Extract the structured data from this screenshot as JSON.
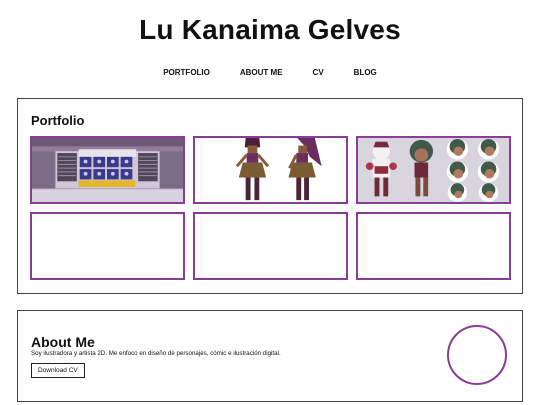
{
  "header": {
    "title": "Lu Kanaima Gelves"
  },
  "nav": {
    "items": [
      "PORTFOLIO",
      "ABOUT ME",
      "CV",
      "BLOG"
    ]
  },
  "portfolio": {
    "heading": "Portfolio",
    "thumbnails": [
      "environment-scene",
      "character-turnaround",
      "character-expression-sheet",
      "empty",
      "empty",
      "empty"
    ]
  },
  "about": {
    "heading": "About Me",
    "text": "Soy ilustradora y artista 2D. Me enfoco en diseño de personajes, cómic e ilustración digital.",
    "button_label": "Download CV"
  },
  "colors": {
    "accent": "#8a3d96",
    "border": "#444444"
  }
}
